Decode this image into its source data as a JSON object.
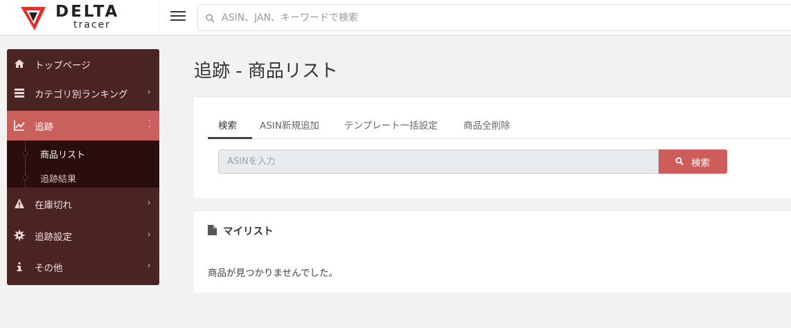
{
  "brand": {
    "name": "DELTA",
    "sub": "tracer",
    "logo_icon": "delta-logo-icon"
  },
  "top_search": {
    "placeholder": "ASIN、JAN、キーワードで検索",
    "icon": "search-icon"
  },
  "sidebar": {
    "items": [
      {
        "label": "トップページ",
        "icon": "home-icon",
        "chevron": ""
      },
      {
        "label": "カテゴリ別ランキング",
        "icon": "list-icon",
        "chevron": "›"
      },
      {
        "label": "追跡",
        "icon": "chart-line-icon",
        "chevron": "⁚"
      },
      {
        "label": "在庫切れ",
        "icon": "warning-icon",
        "chevron": "›"
      },
      {
        "label": "追跡設定",
        "icon": "gear-icon",
        "chevron": "›"
      },
      {
        "label": "その他",
        "icon": "info-icon",
        "chevron": "›"
      }
    ],
    "submenu": [
      {
        "label": "商品リスト"
      },
      {
        "label": "追跡結果"
      }
    ]
  },
  "main": {
    "title": "追跡 - 商品リスト",
    "tabs": [
      {
        "label": "検索"
      },
      {
        "label": "ASIN新規追加"
      },
      {
        "label": "テンプレート一括設定"
      },
      {
        "label": "商品全削除"
      }
    ],
    "asin_input": {
      "placeholder": "ASINを入力",
      "value": ""
    },
    "search_button": "検索",
    "mylist": {
      "title": "マイリスト",
      "empty_message": "商品が見つかりませんでした。"
    }
  },
  "colors": {
    "sidebar_bg": "#4a2323",
    "sidebar_active": "#c9605e",
    "submenu_bg": "#2a0d0d",
    "accent_button": "#cd5c5a",
    "page_bg": "#f2f2f2"
  }
}
